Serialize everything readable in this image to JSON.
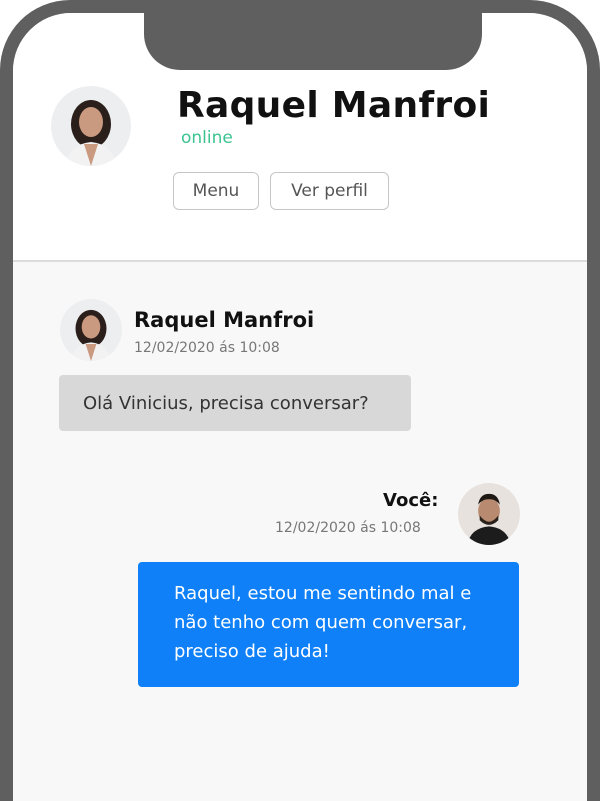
{
  "contact": {
    "name": "Raquel Manfroi",
    "status": "online"
  },
  "header_buttons": {
    "menu": "Menu",
    "profile": "Ver perfil"
  },
  "messages": [
    {
      "sender": "Raquel Manfroi",
      "timestamp": "12/02/2020 ás 10:08",
      "text": "Olá Vinicius, precisa conversar?",
      "direction": "incoming"
    },
    {
      "sender": "Você:",
      "timestamp": "12/02/2020 ás 10:08",
      "text": "Raquel, estou me sentindo mal e não tenho com quem conversar, preciso de ajuda!",
      "direction": "outgoing"
    }
  ],
  "colors": {
    "status": "#3cc490",
    "outgoing_bubble": "#0f80f7",
    "incoming_bubble": "#d8d8d8",
    "phone_frame": "#5f5f5f"
  }
}
